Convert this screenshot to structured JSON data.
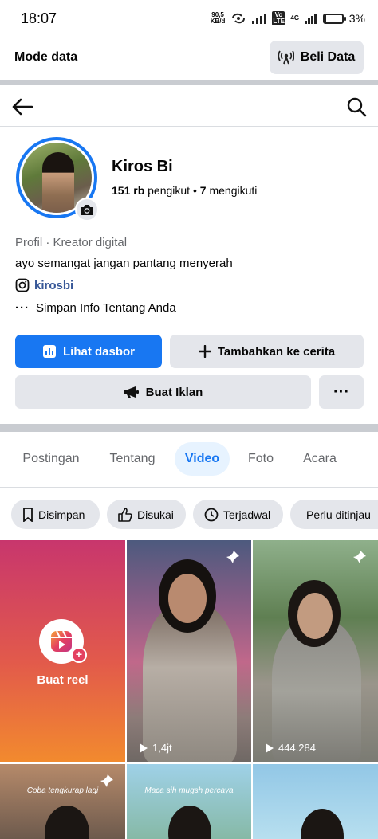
{
  "status_bar": {
    "time": "18:07",
    "net_speed": "90,5",
    "net_unit": "KB/d",
    "lte": "Vo LTE",
    "signal2": "4G+",
    "battery": "3%"
  },
  "data_bar": {
    "label": "Mode data",
    "button": "Beli Data"
  },
  "profile": {
    "name": "Kiros Bi",
    "followers": "151 rb",
    "followers_label": "pengikut",
    "following": "7",
    "following_label": "mengikuti",
    "category": "Profil · Kreator digital",
    "bio": "ayo semangat jangan pantang menyerah",
    "instagram": "kirosbi",
    "info": "Simpan Info Tentang Anda"
  },
  "buttons": {
    "dashboard": "Lihat dasbor",
    "add_story": "Tambahkan ke cerita",
    "ads": "Buat Iklan",
    "more": "···"
  },
  "tabs": [
    "Postingan",
    "Tentang",
    "Video",
    "Foto",
    "Acara"
  ],
  "active_tab": "Video",
  "chips": [
    "Disimpan",
    "Disukai",
    "Terjadwal",
    "Perlu ditinjau"
  ],
  "grid": {
    "reel_label": "Buat reel",
    "views_1": "1,4jt",
    "views_2": "444.284",
    "caption_a": "Coba tengkurap lagi",
    "caption_b": "Maca sih mugsh percaya"
  },
  "colors": {
    "accent": "#1877f2",
    "chip_bg": "#e4e6eb",
    "divider": "#c9ccd1"
  }
}
